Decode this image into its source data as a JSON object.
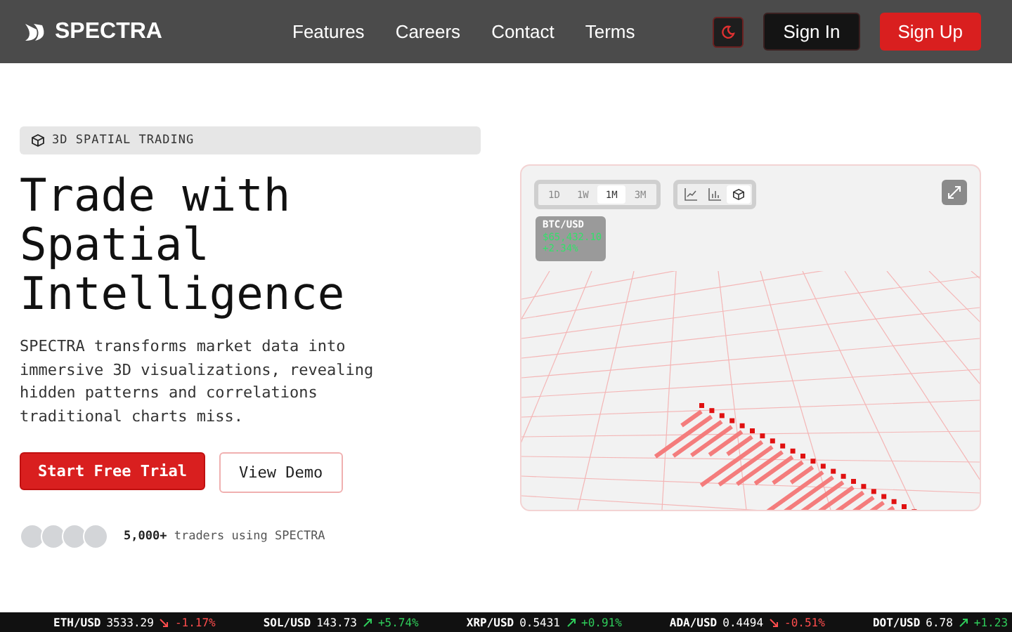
{
  "nav": {
    "brand": "SPECTRA",
    "links": [
      "Features",
      "Careers",
      "Contact",
      "Terms"
    ],
    "sign_in": "Sign In",
    "sign_up": "Sign Up"
  },
  "hero": {
    "badge": "3D SPATIAL TRADING",
    "title_lines": [
      "Trade with",
      "Spatial",
      "Intelligence"
    ],
    "description": "SPECTRA transforms market data into immersive 3D visualizations, revealing hidden patterns and correlations traditional charts miss.",
    "primary_button": "Start Free Trial",
    "secondary_button": "View Demo",
    "social_proof_count": "5,000+",
    "social_proof_text": "traders using SPECTRA"
  },
  "chart_panel": {
    "ranges": [
      {
        "label": "1D",
        "selected": false
      },
      {
        "label": "1W",
        "selected": false
      },
      {
        "label": "1M",
        "selected": true
      },
      {
        "label": "3M",
        "selected": false
      }
    ],
    "views": [
      {
        "kind": "line",
        "selected": false
      },
      {
        "kind": "bar",
        "selected": false
      },
      {
        "kind": "cube",
        "selected": true
      }
    ],
    "symbol": "BTC/USD",
    "price": "$65,432.10",
    "change": "+2.34%"
  },
  "ticker": [
    {
      "pair": "ETH/USD",
      "price": "3533.29",
      "rising": false,
      "change": "-1.17%"
    },
    {
      "pair": "SOL/USD",
      "price": "143.73",
      "rising": true,
      "change": "+5.74%"
    },
    {
      "pair": "XRP/USD",
      "price": "0.5431",
      "rising": true,
      "change": "+0.91%"
    },
    {
      "pair": "ADA/USD",
      "price": "0.4494",
      "rising": false,
      "change": "-0.51%"
    },
    {
      "pair": "DOT/USD",
      "price": "6.78",
      "rising": true,
      "change": "+1.23"
    }
  ]
}
